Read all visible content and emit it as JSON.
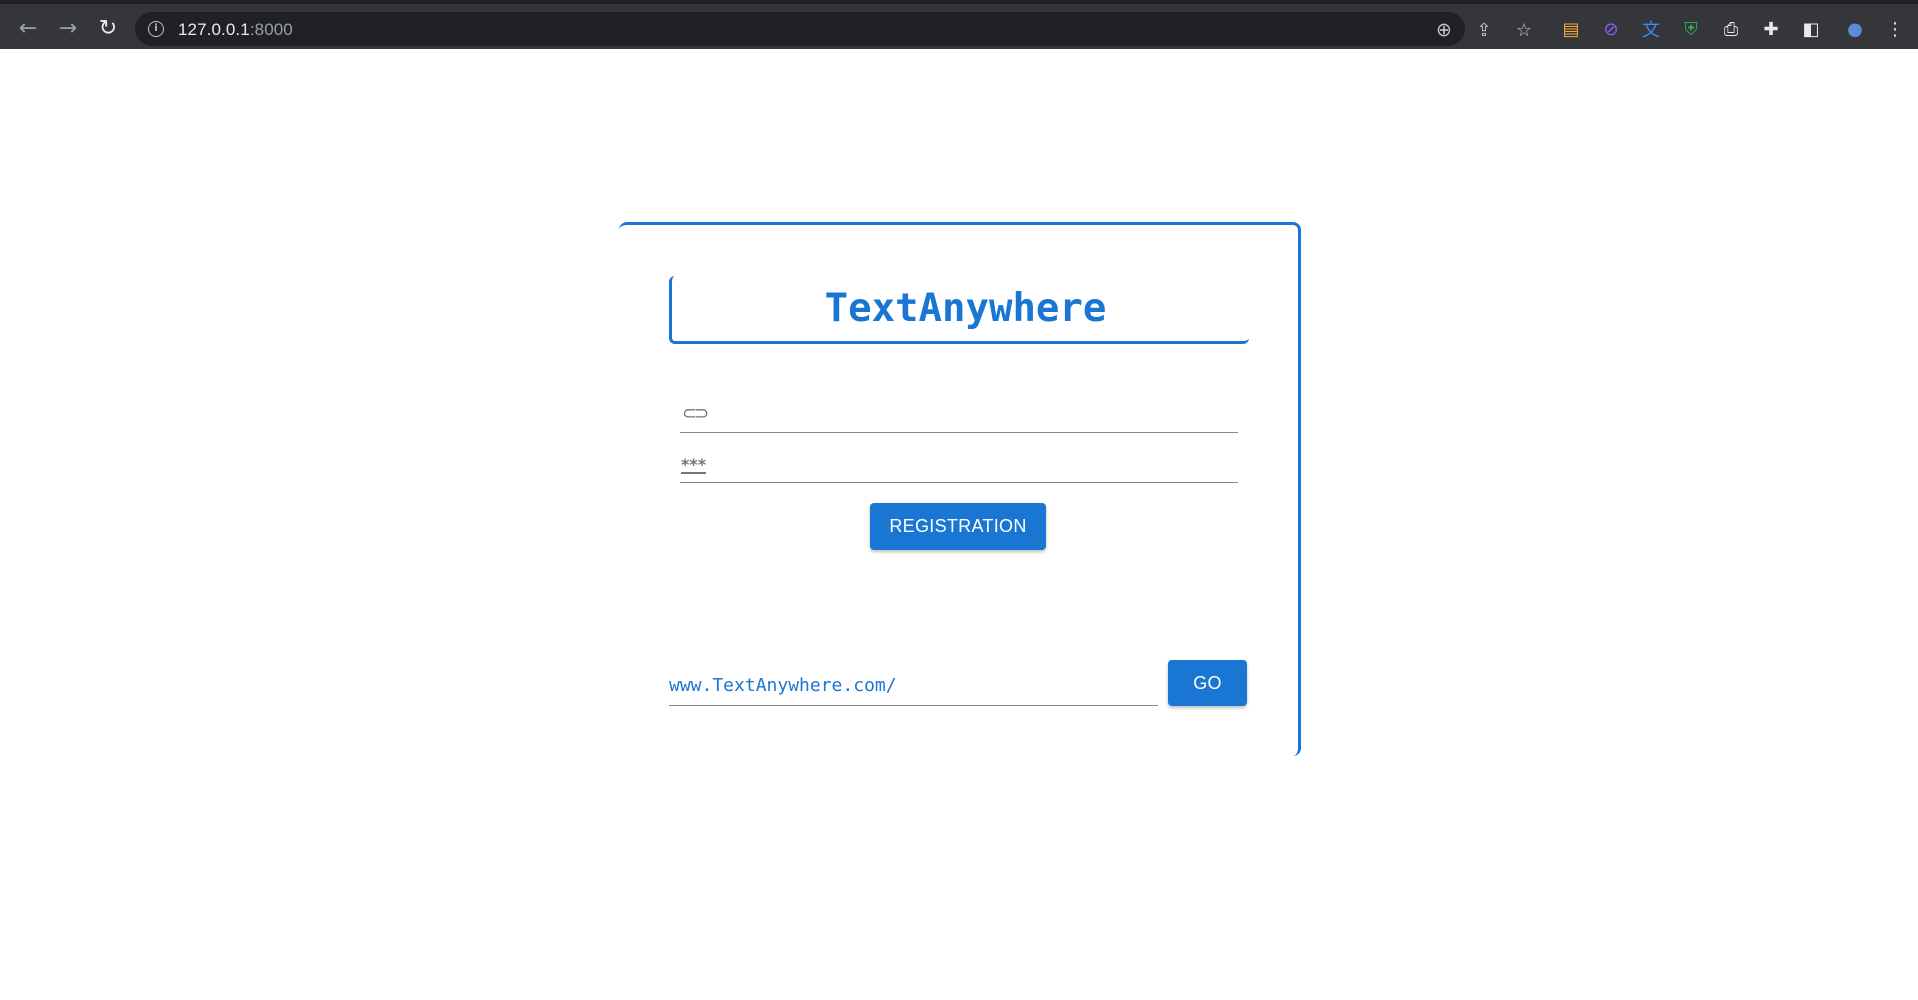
{
  "browser": {
    "url_host": "127.0.0.1",
    "url_port": ":8000",
    "back_icon": "arrow-left-icon",
    "forward_icon": "arrow-right-icon",
    "reload_icon": "reload-icon",
    "back_glyph": "←",
    "forward_glyph": "→",
    "reload_glyph": "↻",
    "info_glyph": "i",
    "zoom_glyph": "⊕",
    "share_glyph": "⇪",
    "star_glyph": "☆",
    "extensions": [
      {
        "name": "google-tasks-extension-icon",
        "glyph": "▤",
        "color": "#f2a93b"
      },
      {
        "name": "link-shortener-extension-icon",
        "glyph": "⊘",
        "color": "#8b5cf6"
      },
      {
        "name": "translate-extension-icon",
        "glyph": "文",
        "color": "#4285f4"
      },
      {
        "name": "shield-extension-icon",
        "glyph": "⛨",
        "color": "#34a853"
      },
      {
        "name": "printer-extension-icon",
        "glyph": "⎙",
        "color": "#e8eaed"
      },
      {
        "name": "puzzle-extensions-icon",
        "glyph": "✚",
        "color": "#e8eaed"
      },
      {
        "name": "side-panel-icon",
        "glyph": "◧",
        "color": "#e8eaed"
      },
      {
        "name": "profile-avatar-icon",
        "glyph": "●",
        "color": "#5b8bd6"
      },
      {
        "name": "menu-kebab-icon",
        "glyph": "⋮",
        "color": "#e8eaed"
      }
    ]
  },
  "app": {
    "title": "TextAnywhere",
    "link_icon": "link-icon",
    "link_glyph": "⊂⊃",
    "password_icon": "password-icon",
    "password_glyph": "***",
    "link_value": "",
    "password_value": "",
    "registration_label": "REGISTRATION",
    "url_prefix": "www.TextAnywhere.com/",
    "url_value": "",
    "go_label": "GO",
    "accent_color": "#1976d2"
  }
}
